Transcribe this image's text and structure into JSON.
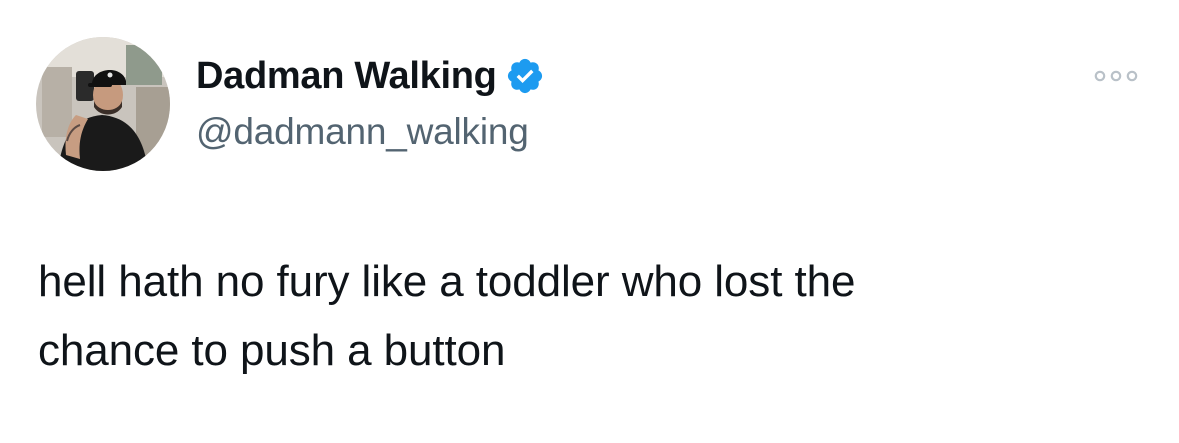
{
  "author": {
    "display_name": "Dadman Walking",
    "handle": "@dadmann_walking",
    "verified": true,
    "avatar_icon": "profile-photo"
  },
  "tweet": {
    "text_lines": [
      "hell hath no fury like a toddler who lost the",
      "chance to push a button"
    ]
  },
  "menu": {
    "icon": "more-options-icon"
  },
  "colors": {
    "verified_blue": "#1d9bf0",
    "handle_gray": "#536471",
    "text": "#0f1419",
    "more_gray": "#b9c1c8"
  }
}
